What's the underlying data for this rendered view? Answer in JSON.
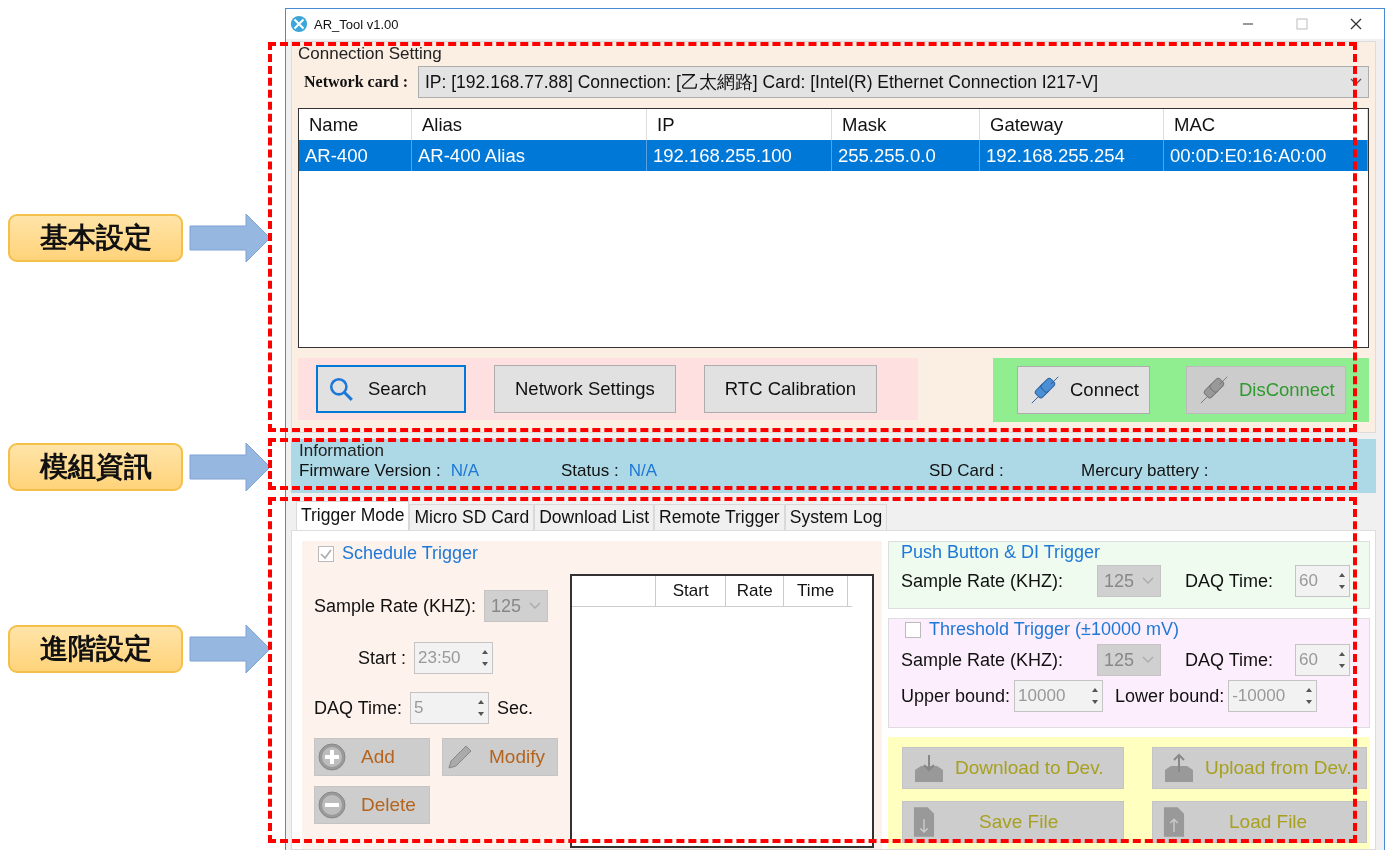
{
  "annotations": [
    {
      "label": "基本設定"
    },
    {
      "label": "模組資訊"
    },
    {
      "label": "進階設定"
    }
  ],
  "window": {
    "title": "AR_Tool v1.00"
  },
  "connection": {
    "title": "Connection Setting",
    "network_card_label": "Network card :",
    "network_card_value": "IP: [192.168.77.88] Connection: [乙太網路] Card: [Intel(R) Ethernet Connection I217-V]",
    "table": {
      "columns": [
        "Name",
        "Alias",
        "IP",
        "Mask",
        "Gateway",
        "MAC"
      ],
      "rows": [
        {
          "selected": true,
          "cells": [
            "AR-400",
            "AR-400 Alias",
            "192.168.255.100",
            "255.255.0.0",
            "192.168.255.254",
            "00:0D:E0:16:A0:00"
          ]
        }
      ]
    },
    "buttons": [
      {
        "label": "Search",
        "kind": "search"
      },
      {
        "label": "Network Settings",
        "kind": "plain"
      },
      {
        "label": "RTC Calibration",
        "kind": "plain"
      }
    ],
    "link_buttons": [
      {
        "label": "Connect",
        "disabled": false
      },
      {
        "label": "DisConnect",
        "disabled": true
      }
    ]
  },
  "information": {
    "title": "Information",
    "fields": [
      {
        "label": "Firmware Version :",
        "value": "N/A"
      },
      {
        "label": "Status :",
        "value": "N/A"
      },
      {
        "label": "SD Card :"
      },
      {
        "label": "Mercury battery :"
      }
    ]
  },
  "tabs": [
    {
      "label": "Trigger Mode",
      "selected": true
    },
    {
      "label": "Micro SD Card",
      "selected": false
    },
    {
      "label": "Download List",
      "selected": false
    },
    {
      "label": "Remote Trigger",
      "selected": false
    },
    {
      "label": "System Log",
      "selected": false
    }
  ],
  "schedule": {
    "title": "Schedule Trigger",
    "checked": true,
    "sample_rate_label": "Sample Rate (KHZ):",
    "sample_rate": "125",
    "start_label": "Start :",
    "start": "23:50",
    "daq_label": "DAQ Time:",
    "daq": "5",
    "unit": "Sec.",
    "buttons": [
      {
        "label": "Add",
        "kind": "add"
      },
      {
        "label": "Modify",
        "kind": "modify"
      },
      {
        "label": "Delete",
        "kind": "delete"
      }
    ],
    "list_columns": [
      "Start",
      "Rate",
      "Time"
    ]
  },
  "push_trigger": {
    "title": "Push Button & DI Trigger",
    "sample_rate_label": "Sample Rate (KHZ):",
    "sample_rate": "125",
    "daq_label": "DAQ Time:",
    "daq": "60"
  },
  "threshold_trigger": {
    "title": "Threshold Trigger (±10000 mV)",
    "checked": false,
    "sample_rate_label": "Sample Rate (KHZ):",
    "sample_rate": "125",
    "daq_label": "DAQ Time:",
    "daq": "60",
    "upper_label": "Upper bound:",
    "upper": "10000",
    "lower_label": "Lower bound:",
    "lower": "-10000"
  },
  "file_buttons": [
    {
      "label": "Download to Dev.",
      "kind": "download"
    },
    {
      "label": "Upload from Dev.",
      "kind": "upload"
    },
    {
      "label": "Save File",
      "kind": "save"
    },
    {
      "label": "Load File",
      "kind": "load"
    }
  ]
}
